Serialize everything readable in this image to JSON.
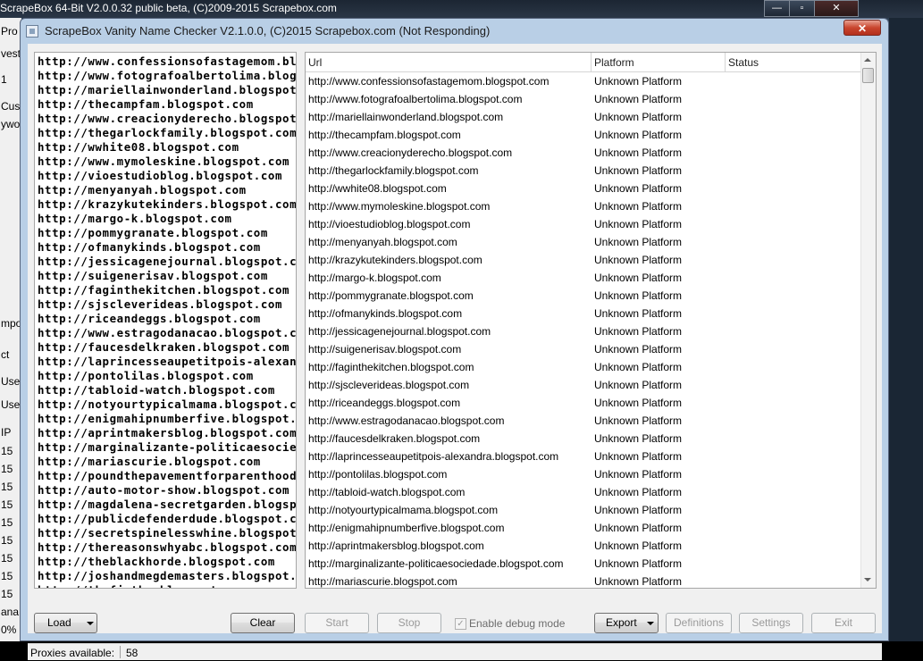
{
  "background_window": {
    "title": "ScrapeBox 64-Bit V2.0.0.32 public beta, (C)2009-2015 Scrapebox.com",
    "fragments": [
      "Pro",
      "vest",
      "1",
      "Cus",
      "ywo",
      "mpo",
      "ct",
      "Use",
      "Use",
      "IP",
      "15",
      "15",
      "15",
      "15",
      "15",
      "15",
      "15",
      "15",
      "15",
      "ana",
      "0%"
    ],
    "controls": {
      "minimize": "—",
      "maximize": "▫",
      "close": "✕"
    }
  },
  "dialog": {
    "title": "ScrapeBox Vanity Name Checker V2.1.0.0, (C)2015 Scrapebox.com (Not Responding)",
    "close_glyph": "✕"
  },
  "url_textbox": {
    "lines": [
      "http://www.confessionsofastagemom.blogspot.com",
      "http://www.fotografoalbertolima.blogspot.com",
      "http://mariellainwonderland.blogspot.com",
      "http://thecampfam.blogspot.com",
      "http://www.creacionyderecho.blogspot.com",
      "http://thegarlockfamily.blogspot.com",
      "http://wwhite08.blogspot.com",
      "http://www.mymoleskine.blogspot.com",
      "http://vioestudioblog.blogspot.com",
      "http://menyanyah.blogspot.com",
      "http://krazykutekinders.blogspot.com",
      "http://margo-k.blogspot.com",
      "http://pommygranate.blogspot.com",
      "http://ofmanykinds.blogspot.com",
      "http://jessicagenejournal.blogspot.com",
      "http://suigenerisav.blogspot.com",
      "http://faginthekitchen.blogspot.com",
      "http://sjscleverideas.blogspot.com",
      "http://riceandeggs.blogspot.com",
      "http://www.estragodanacao.blogspot.com",
      "http://faucesdelkraken.blogspot.com",
      "http://laprincesseaupetitpois-alexandra.blogspot.com",
      "http://pontolilas.blogspot.com",
      "http://tabloid-watch.blogspot.com",
      "http://notyourtypicalmama.blogspot.com",
      "http://enigmahipnumberfive.blogspot.com",
      "http://aprintmakersblog.blogspot.com",
      "http://marginalizante-politicaesociedade.blogspot.com",
      "http://mariascurie.blogspot.com",
      "http://poundthepavementforparenthood.blogspot.com",
      "http://auto-motor-show.blogspot.com",
      "http://magdalena-secretgarden.blogspot.com",
      "http://publicdefenderdude.blogspot.com",
      "http://secretspinelesswhine.blogspot.com",
      "http://thereasonswhyabc.blogspot.com",
      "http://theblackhorde.blogspot.com",
      "http://joshandmegdemasters.blogspot.com",
      "http://thefjuthe.blogspot.com"
    ]
  },
  "list_view": {
    "columns": [
      "Url",
      "Platform",
      "Status"
    ],
    "rows": [
      {
        "url": "http://www.confessionsofastagemom.blogspot.com",
        "platform": "Unknown Platform",
        "status": ""
      },
      {
        "url": "http://www.fotografoalbertolima.blogspot.com",
        "platform": "Unknown Platform",
        "status": ""
      },
      {
        "url": "http://mariellainwonderland.blogspot.com",
        "platform": "Unknown Platform",
        "status": ""
      },
      {
        "url": "http://thecampfam.blogspot.com",
        "platform": "Unknown Platform",
        "status": ""
      },
      {
        "url": "http://www.creacionyderecho.blogspot.com",
        "platform": "Unknown Platform",
        "status": ""
      },
      {
        "url": "http://thegarlockfamily.blogspot.com",
        "platform": "Unknown Platform",
        "status": ""
      },
      {
        "url": "http://wwhite08.blogspot.com",
        "platform": "Unknown Platform",
        "status": ""
      },
      {
        "url": "http://www.mymoleskine.blogspot.com",
        "platform": "Unknown Platform",
        "status": ""
      },
      {
        "url": "http://vioestudioblog.blogspot.com",
        "platform": "Unknown Platform",
        "status": ""
      },
      {
        "url": "http://menyanyah.blogspot.com",
        "platform": "Unknown Platform",
        "status": ""
      },
      {
        "url": "http://krazykutekinders.blogspot.com",
        "platform": "Unknown Platform",
        "status": ""
      },
      {
        "url": "http://margo-k.blogspot.com",
        "platform": "Unknown Platform",
        "status": ""
      },
      {
        "url": "http://pommygranate.blogspot.com",
        "platform": "Unknown Platform",
        "status": ""
      },
      {
        "url": "http://ofmanykinds.blogspot.com",
        "platform": "Unknown Platform",
        "status": ""
      },
      {
        "url": "http://jessicagenejournal.blogspot.com",
        "platform": "Unknown Platform",
        "status": ""
      },
      {
        "url": "http://suigenerisav.blogspot.com",
        "platform": "Unknown Platform",
        "status": ""
      },
      {
        "url": "http://faginthekitchen.blogspot.com",
        "platform": "Unknown Platform",
        "status": ""
      },
      {
        "url": "http://sjscleverideas.blogspot.com",
        "platform": "Unknown Platform",
        "status": ""
      },
      {
        "url": "http://riceandeggs.blogspot.com",
        "platform": "Unknown Platform",
        "status": ""
      },
      {
        "url": "http://www.estragodanacao.blogspot.com",
        "platform": "Unknown Platform",
        "status": ""
      },
      {
        "url": "http://faucesdelkraken.blogspot.com",
        "platform": "Unknown Platform",
        "status": ""
      },
      {
        "url": "http://laprincesseaupetitpois-alexandra.blogspot.com",
        "platform": "Unknown Platform",
        "status": ""
      },
      {
        "url": "http://pontolilas.blogspot.com",
        "platform": "Unknown Platform",
        "status": ""
      },
      {
        "url": "http://tabloid-watch.blogspot.com",
        "platform": "Unknown Platform",
        "status": ""
      },
      {
        "url": "http://notyourtypicalmama.blogspot.com",
        "platform": "Unknown Platform",
        "status": ""
      },
      {
        "url": "http://enigmahipnumberfive.blogspot.com",
        "platform": "Unknown Platform",
        "status": ""
      },
      {
        "url": "http://aprintmakersblog.blogspot.com",
        "platform": "Unknown Platform",
        "status": ""
      },
      {
        "url": "http://marginalizante-politicaesociedade.blogspot.com",
        "platform": "Unknown Platform",
        "status": ""
      },
      {
        "url": "http://mariascurie.blogspot.com",
        "platform": "Unknown Platform",
        "status": ""
      }
    ]
  },
  "buttons": {
    "load": "Load",
    "clear": "Clear",
    "start": "Start",
    "stop": "Stop",
    "debug_mode": "Enable debug mode",
    "debug_check_glyph": "✓",
    "export": "Export",
    "definitions": "Definitions",
    "settings": "Settings",
    "exit": "Exit"
  },
  "statusbar": {
    "label": "Proxies available:",
    "value": "58"
  }
}
